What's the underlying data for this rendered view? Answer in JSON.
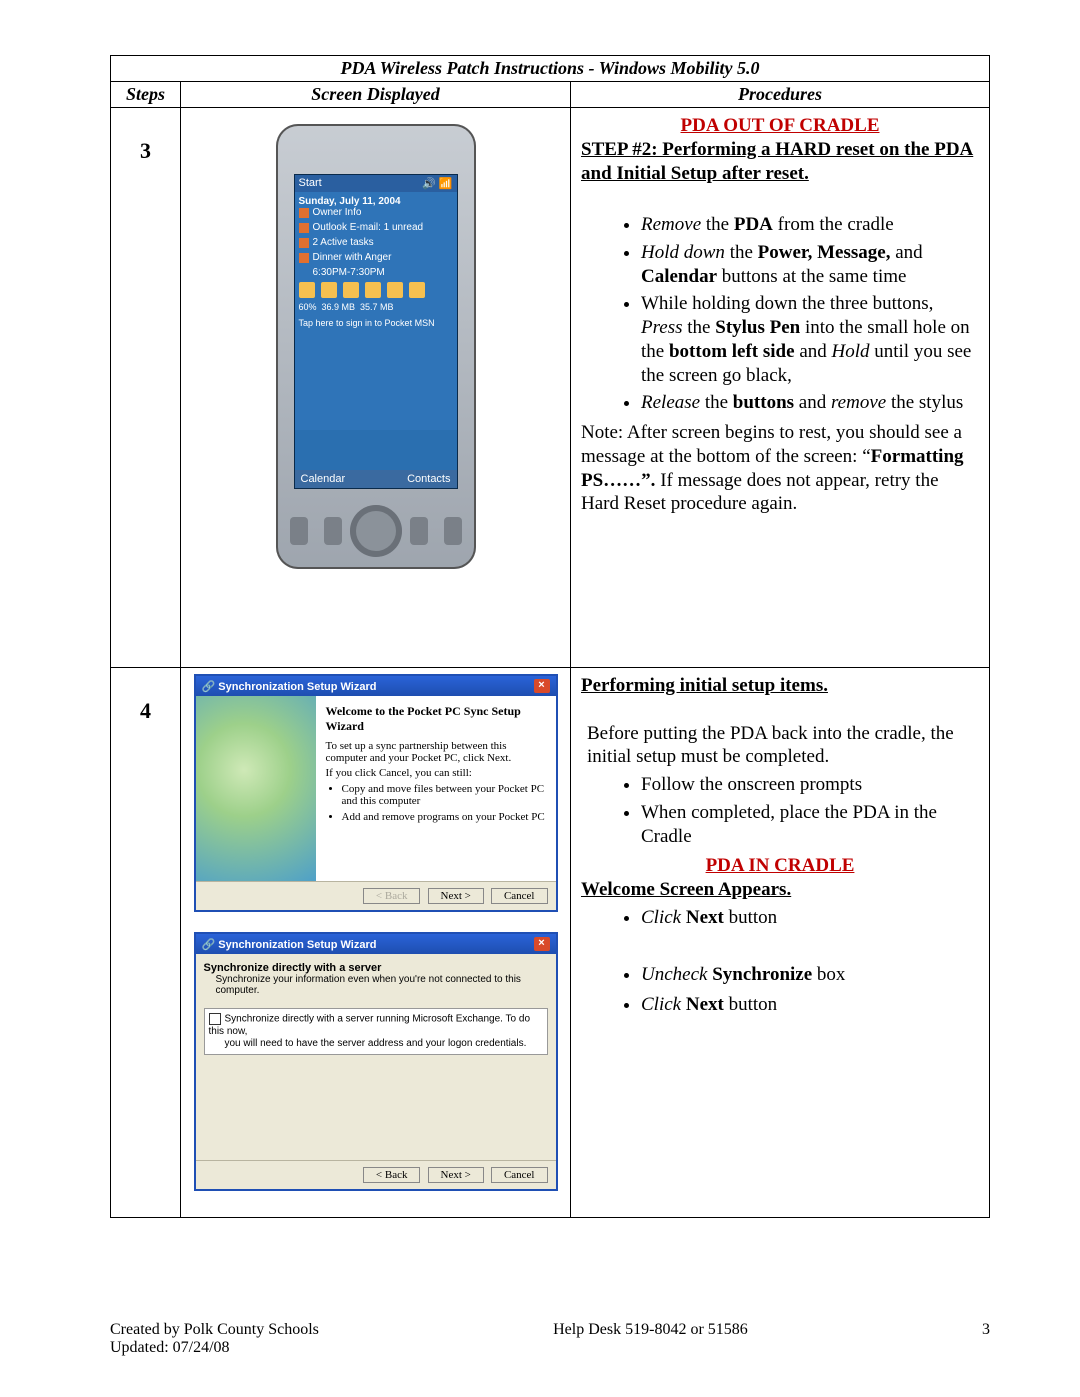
{
  "title": "PDA Wireless Patch Instructions - Windows Mobility 5.0",
  "headers": {
    "steps": "Steps",
    "screen": "Screen Displayed",
    "proc": "Procedures"
  },
  "row3": {
    "num": "3",
    "proc_heading": "PDA OUT OF CRADLE",
    "step_title": "STEP #2: Performing a HARD reset on the PDA and Initial Setup after reset.",
    "bullets_html": [
      "<span class='ital'>Remove</span> the <b>PDA</b> from the cradle",
      "<span class='ital'>Hold down</span> the <b>Power, Message,</b> and <b>Calendar</b> buttons at the same time",
      "While holding down the three buttons, <span class='ital'>Press</span> the <b>Stylus Pen</b> into the small hole on the <b>bottom left side</b> and <span class='ital'>Hold</span> until you see the screen go black,",
      "<span class='ital'>Release</span> the <b>buttons</b> and <span class='ital'>remove</span> the stylus"
    ],
    "note_html": "Note: After screen begins to rest, you should see a message at the bottom of the screen: &ldquo;<b>Formatting PS&hellip;&hellip;&rdquo;.</b> If message does not appear, retry the Hard Reset procedure again."
  },
  "row4": {
    "num": "4",
    "h1": "Performing initial setup items.",
    "intro": "Before putting the PDA back into the cradle, the initial setup must be completed.",
    "b1": "Follow the onscreen prompts",
    "b2": "When completed, place the PDA in the Cradle",
    "red": "PDA IN CRADLE",
    "h2": "Welcome Screen Appears.",
    "b3_html": "<span class='ital'>Click</span> <b>Next</b> button",
    "b4_html": "<span class='ital'>Uncheck</span> <b>Synchronize</b> box",
    "b5_html": "<span class='ital'>Click</span> <b>Next</b> button"
  },
  "pda": {
    "start": "Start",
    "date": "Sunday, July 11, 2004",
    "items": [
      "Owner Info",
      "Outlook E-mail: 1 unread",
      "2 Active tasks",
      "Dinner with Anger",
      "6:30PM-7:30PM"
    ],
    "soft_left": "Calendar",
    "soft_right": "Contacts",
    "tap": "Tap here to sign in to Pocket MSN"
  },
  "wiz1": {
    "title": "Synchronization Setup Wizard",
    "h": "Welcome to the Pocket PC Sync Setup Wizard",
    "p1": "To set up a sync partnership between this computer and your Pocket PC, click Next.",
    "p2": "If you click Cancel, you can still:",
    "li1": "Copy and move files between your Pocket PC and this computer",
    "li2": "Add and remove programs on your Pocket PC",
    "back": "< Back",
    "next": "Next >",
    "cancel": "Cancel"
  },
  "wiz2": {
    "title": "Synchronization Setup Wizard",
    "sub": "Synchronize directly with a server",
    "desc": "Synchronize your information even when you're not connected to this computer.",
    "opt1": "Synchronize directly with a server running Microsoft Exchange. To do this now,",
    "opt2": "you will need to have the server address and your logon credentials.",
    "back": "< Back",
    "next": "Next >",
    "cancel": "Cancel"
  },
  "footer": {
    "left1": "Created by Polk County Schools",
    "left2": "Updated: 07/24/08",
    "center": "Help Desk 519-8042 or 51586",
    "page": "3"
  }
}
